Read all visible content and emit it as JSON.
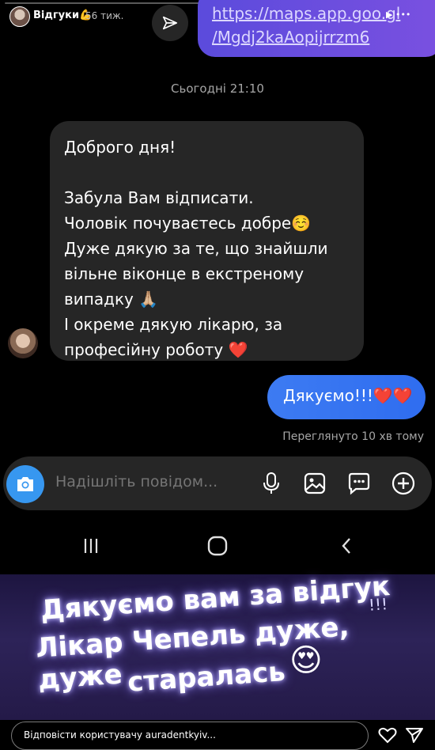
{
  "story": {
    "name": "Відгуки💪",
    "age": "56 тиж.",
    "link": "https://maps.app.goo.gl\n/Mgdj2kaAopijrrzm6"
  },
  "chat": {
    "timestamp": "Сьогодні 21:10",
    "incoming_message": "Доброго дня!\n\nЗабула Вам відписати.\nЧоловік почуваєтесь добре☺️\nДуже дякую за те, що знайшли вільне віконце в екстреному випадку 🙏🏼\nІ окреме дякую лікарю, за професійну роботу ❤️",
    "outgoing_message": "Дякуємо!!!❤️❤️",
    "seen_status": "Переглянуто 10 хв тому"
  },
  "composer": {
    "placeholder": "Надішліть повідом..."
  },
  "banner": {
    "line1": "Дякуємо вам за відгук",
    "excl": "!!!",
    "line2": "Лікар Чепель дуже, дуже",
    "line3": "старалась",
    "emoji": "😍"
  },
  "footer": {
    "reply_placeholder": "Відповісти користувачу auradentkyiv..."
  },
  "colors": {
    "incoming_bubble": "#262626",
    "outgoing_bubble": "#3478f6",
    "link_bubble": "#6a4fe0",
    "camera_button": "#3797f0"
  },
  "icons": [
    "send-icon",
    "camera-icon",
    "microphone-icon",
    "gallery-icon",
    "sticker-icon",
    "add-icon",
    "recents-icon",
    "home-icon",
    "back-icon",
    "heart-icon",
    "paper-plane-icon"
  ]
}
